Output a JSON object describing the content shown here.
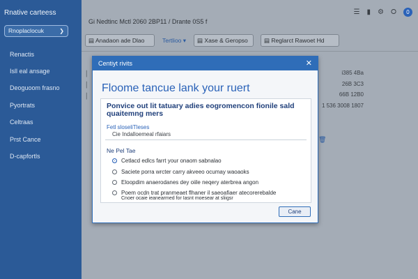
{
  "sidebar": {
    "title": "Rnative carteess",
    "button_label": "Rnoplaclocuk",
    "items": [
      "Renactis",
      "Isll eal ansage",
      "Deoguoom frasno",
      "Pyortrats",
      "Celtraas",
      "Prst Cance",
      "D-capfortls"
    ]
  },
  "header": {
    "breadcrumb": "Gi Nedtinc Mctl 2060 2BP11 / Drante 0S5 f",
    "avatar_letter": "0"
  },
  "toolbar": {
    "btn1": "Anadaon ade Dlao",
    "link": "Tertlioo ▾",
    "btn2": "Xase & Geropso",
    "btn3": "Reglarct Rawoet Hd"
  },
  "rows": {
    "values": [
      "i385 4Ba",
      "26B 3C3",
      "66B 12B0",
      "1 536 3008 1807"
    ],
    "trash": "⏴"
  },
  "dialog": {
    "window_title": "Centiyt rivits",
    "heading": "Floome tancue lank your ruert",
    "headline": "Ponvice out lit tatuary adies eogromencon fionile sald quaitemng mers",
    "caption1": "Fetl sloseliTleses",
    "caption2": "Cie Indalloemeal rfaiars",
    "group_label": "Ne Pel Tae",
    "options": [
      "Cetlacd edlcs farrt your onaom sabnalao",
      "Saciete porra wrcter carry akveeo ocumay waoaoks",
      "Eloopdim anaerodanes dey oiile neqery aterbrea angon",
      "Poem ocdn trat pranmeaet flhaner il saeoafiaer atecorerebalde"
    ],
    "option_sub": "Cnoer ocaie ieanearmed for Iasnt moesear at sliigsr",
    "ok_label": "Cane"
  }
}
